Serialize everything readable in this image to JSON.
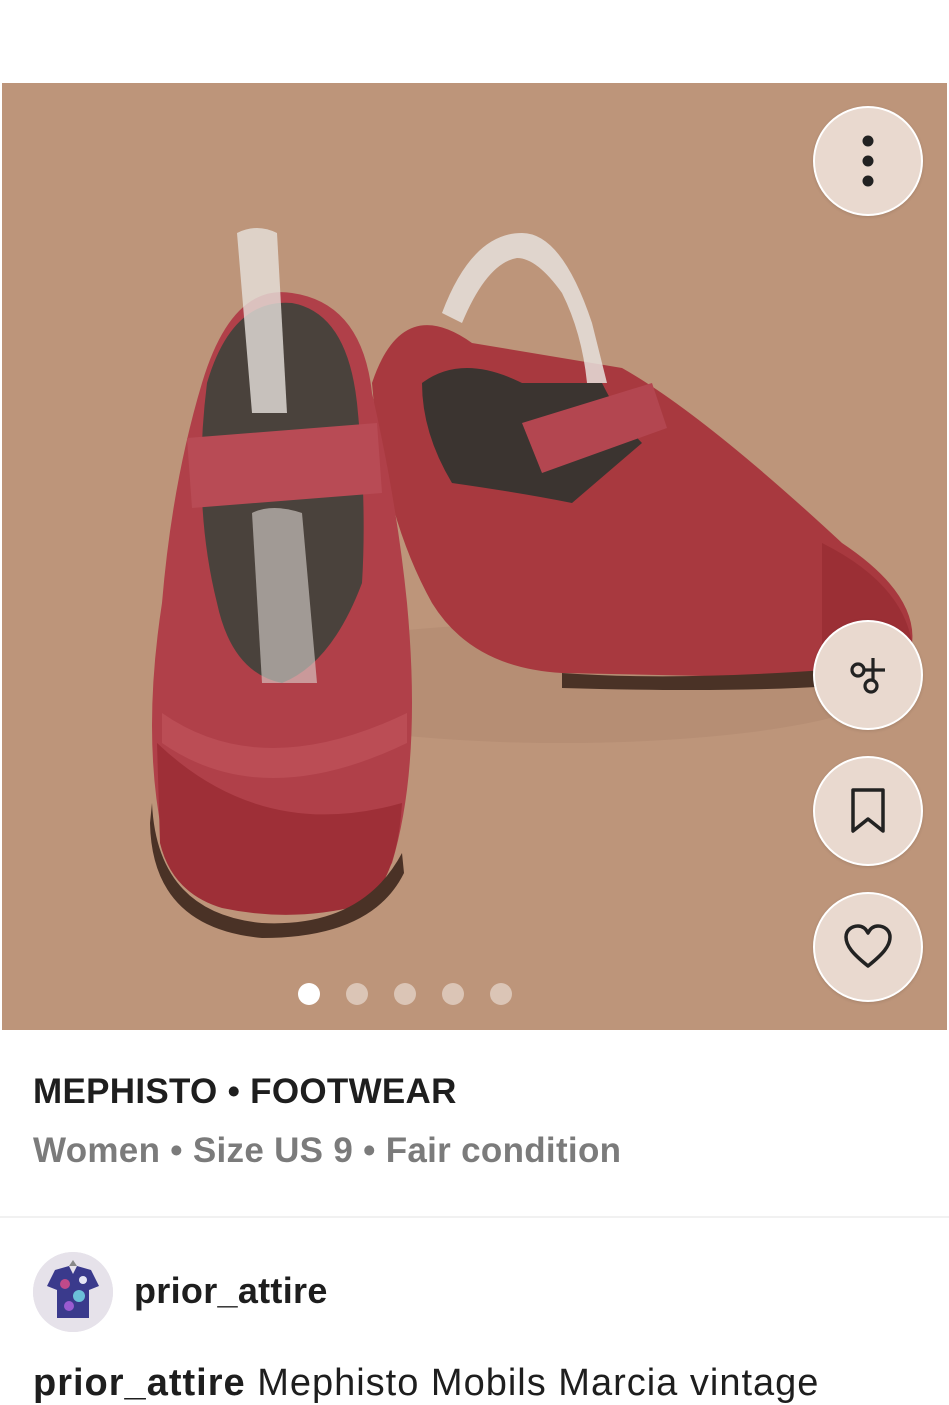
{
  "listing": {
    "brand_line": "MEPHISTO • FOOTWEAR",
    "details_line": "Women • Size US 9 • Fair condition"
  },
  "gallery": {
    "image_count": 5,
    "active_index": 0,
    "background_color": "#bd957a",
    "shoe_color": "#b5464f"
  },
  "actions": {
    "more_icon": "more-vertical-icon",
    "style_icon": "outfit-cut-icon",
    "save_icon": "bookmark-icon",
    "like_icon": "heart-icon"
  },
  "seller": {
    "username": "prior_attire"
  },
  "caption": {
    "author": "prior_attire",
    "text": "Mephisto Mobils Marcia vintage"
  }
}
